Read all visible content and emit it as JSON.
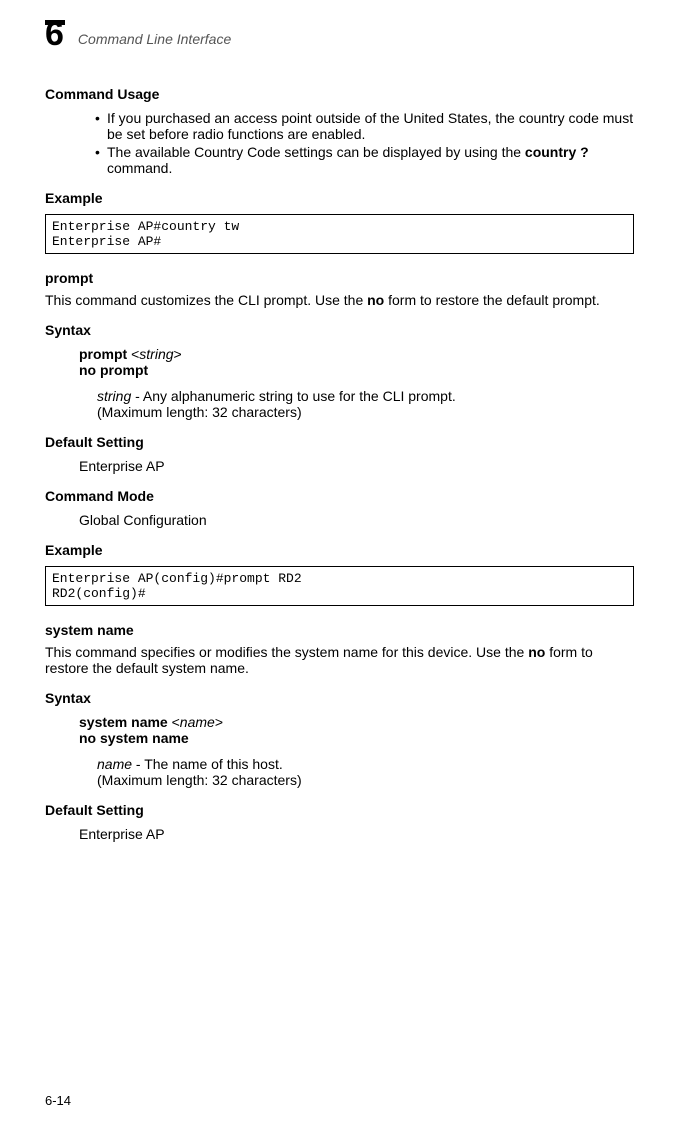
{
  "header": {
    "chapter_number": "6",
    "chapter_title": "Command Line Interface"
  },
  "sec1": {
    "heading": "Command Usage",
    "bullets": [
      {
        "text": "If you purchased an access point outside of the United States, the country code must be set before radio functions are enabled."
      },
      {
        "pre": "The available Country Code settings can be displayed by using the ",
        "bold": "country ?",
        "post": " command."
      }
    ]
  },
  "sec2": {
    "heading": "Example",
    "code": "Enterprise AP#country tw\nEnterprise AP#"
  },
  "prompt": {
    "name": "prompt",
    "desc_pre": "This command customizes the CLI prompt. Use the ",
    "desc_bold": "no",
    "desc_post": " form to restore the default prompt.",
    "syntax_label": "Syntax",
    "syntax_cmd": "prompt",
    "syntax_arg": "string",
    "syntax_no": "no prompt",
    "arg_name": "string",
    "arg_desc": " - Any alphanumeric string to use for the CLI prompt.",
    "arg_note": "(Maximum length: 32 characters)",
    "default_label": "Default Setting",
    "default_value": "Enterprise AP",
    "mode_label": "Command Mode",
    "mode_value": "Global Configuration",
    "example_label": "Example",
    "example_code": "Enterprise AP(config)#prompt RD2\nRD2(config)#"
  },
  "sysname": {
    "name": "system name",
    "desc_pre": "This command specifies or modifies the system name for this device. Use the ",
    "desc_bold": "no",
    "desc_post": " form to restore the default system name.",
    "syntax_label": "Syntax",
    "syntax_cmd": "system name",
    "syntax_arg": "name",
    "syntax_no": "no system name",
    "arg_name": "name",
    "arg_desc": " - The name of this host.",
    "arg_note": "(Maximum length: 32 characters)",
    "default_label": "Default Setting",
    "default_value": "Enterprise AP"
  },
  "footer": {
    "page": "6-14"
  }
}
